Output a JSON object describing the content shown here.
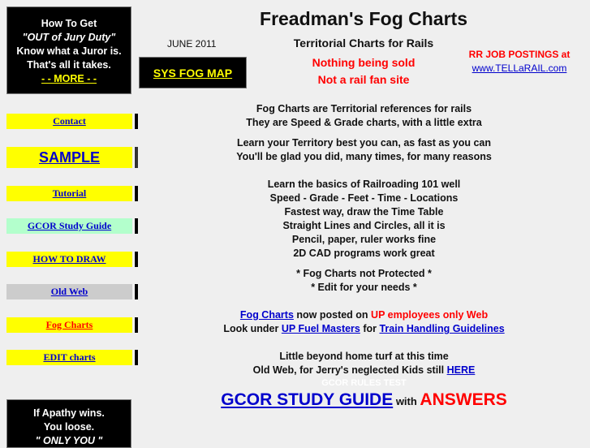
{
  "sidebar": {
    "promo_top": {
      "line1": "How To Get",
      "line2": "\"OUT of Jury Duty\"",
      "line3": "Know what a Juror is.",
      "line4": "That's all it takes.",
      "more_link": "- - MORE - -"
    },
    "nav": [
      {
        "label": "Contact",
        "bg": "#ffff00",
        "color": "#0000cc"
      },
      {
        "label": "SAMPLE",
        "bg": "#ffff00",
        "color": "#0000cc"
      },
      {
        "label": "Tutorial",
        "bg": "#ffff00",
        "color": "#0000cc"
      },
      {
        "label": "GCOR Study Guide",
        "bg": "#b3ffcc",
        "color": "#0000cc"
      },
      {
        "label": "HOW TO DRAW",
        "bg": "#ffff00",
        "color": "#0000cc"
      },
      {
        "label": "Old Web",
        "bg": "#cccccc",
        "color": "#0000cc"
      },
      {
        "label": "Fog Charts",
        "bg": "#ffff00",
        "color": "#ff0000"
      },
      {
        "label": "EDIT charts",
        "bg": "#ffff00",
        "color": "#0000cc"
      }
    ],
    "promo_bottom": {
      "line1": "If Apathy wins.",
      "line2": "You loose.",
      "line3": "\" ONLY  YOU \""
    }
  },
  "header": {
    "date": "JUNE 2011",
    "sys_fog_map": "SYS FOG MAP",
    "title": "Freadman's Fog Charts",
    "subtitle": "Territorial Charts for Rails",
    "red_line1": "Nothing being sold",
    "red_line2": "Not a rail fan site",
    "jobs_label": "RR JOB POSTINGS at",
    "jobs_link": "www.TELLaRAIL.com"
  },
  "main": {
    "p1": [
      "Fog Charts are Territorial references for rails",
      "They are Speed & Grade charts, with a little extra"
    ],
    "p2": [
      "Learn your Territory best you can, as fast as you can",
      "You'll be glad you did, many times, for many reasons"
    ],
    "p3": [
      "Learn the basics of Railroading 101 well",
      "Speed - Grade - Feet - Time - Locations",
      "Fastest way, draw the Time Table",
      "Straight Lines and Circles, all it is",
      "Pencil, paper, ruler works fine",
      "2D CAD programs work great"
    ],
    "p4": [
      "* Fog Charts not Protected *",
      "* Edit for your needs *"
    ],
    "posted": {
      "link": "Fog Charts",
      "text": " now posted on ",
      "red": "UP employees only Web"
    },
    "look": {
      "text1": "Look under ",
      "link1": "UP Fuel Masters",
      "text2": " for ",
      "link2": "Train Handling Guidelines"
    },
    "p6": "Little beyond home turf at this time",
    "oldweb": {
      "text": "Old Web, for Jerry's neglected Kids still ",
      "link": "HERE"
    },
    "hidden": "GCOR RULES TEST",
    "gcor": {
      "link": "GCOR STUDY GUIDE",
      "with": " with ",
      "answers": "ANSWERS"
    }
  }
}
